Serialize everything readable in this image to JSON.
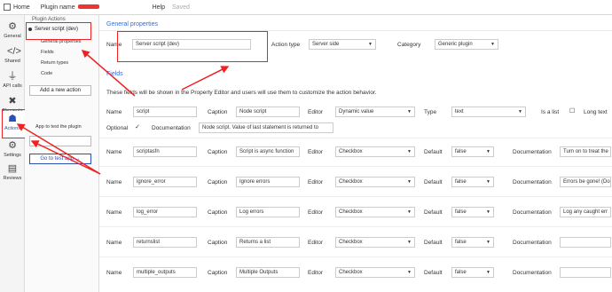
{
  "topbar": {
    "home_label": "Home",
    "plugin_label": "Plugin name",
    "help_label": "Help",
    "saved_label": "Saved"
  },
  "leftnav": {
    "items": [
      {
        "label": "General",
        "icon": "gear-icon"
      },
      {
        "label": "Shared",
        "icon": "code-icon"
      },
      {
        "label": "API calls",
        "icon": "plug-icon"
      },
      {
        "label": "Elements",
        "icon": "tools-icon"
      },
      {
        "label": "Actions",
        "icon": "sitemap-icon"
      },
      {
        "label": "Settings",
        "icon": "gear-icon"
      },
      {
        "label": "Reviews",
        "icon": "document-icon"
      }
    ]
  },
  "submenu": {
    "header": "Plugin Actions",
    "selected": "Server script (dev)",
    "links": [
      "General properties",
      "Fields",
      "Return types",
      "Code"
    ],
    "add_action": "Add a new action",
    "app_test_label": "App to test the plugin",
    "goto_label": "Go to test app →"
  },
  "general": {
    "title": "General properties",
    "name_label": "Name",
    "name_value": "Server script (dev)",
    "action_type_label": "Action type",
    "action_type_value": "Server side",
    "category_label": "Category",
    "category_value": "Generic plugin"
  },
  "fields": {
    "title": "Fields",
    "description": "These fields will be shown in the Property Editor and users will use them to customize the action behavior.",
    "labels": {
      "name": "Name",
      "caption": "Caption",
      "editor": "Editor",
      "type": "Type",
      "default": "Default",
      "documentation": "Documentation",
      "is_list": "Is a list",
      "long_text": "Long text",
      "optional": "Optional"
    },
    "first": {
      "name": "script",
      "caption": "Node script",
      "editor": "Dynamic value",
      "type": "text",
      "documentation": "Node script. Value of last statement is returned to"
    },
    "rows": [
      {
        "name": "scriptasfn",
        "caption": "Script is async function",
        "editor": "Checkbox",
        "default": "false",
        "documentation": "Turn on to treat the"
      },
      {
        "name": "ignore_error",
        "caption": "Ignore errors",
        "editor": "Checkbox",
        "default": "false",
        "documentation": "Errors be gone! (Do"
      },
      {
        "name": "log_error",
        "caption": "Log errors",
        "editor": "Checkbox",
        "default": "false",
        "documentation": "Log any caught err"
      },
      {
        "name": "returnslist",
        "caption": "Returns a list",
        "editor": "Checkbox",
        "default": "false",
        "documentation": ""
      },
      {
        "name": "multiple_outputs",
        "caption": "Multiple Outputs",
        "editor": "Checkbox",
        "default": "false",
        "documentation": ""
      }
    ]
  },
  "colors": {
    "accent": "#3a6bd6",
    "annotation": "#e22222"
  }
}
